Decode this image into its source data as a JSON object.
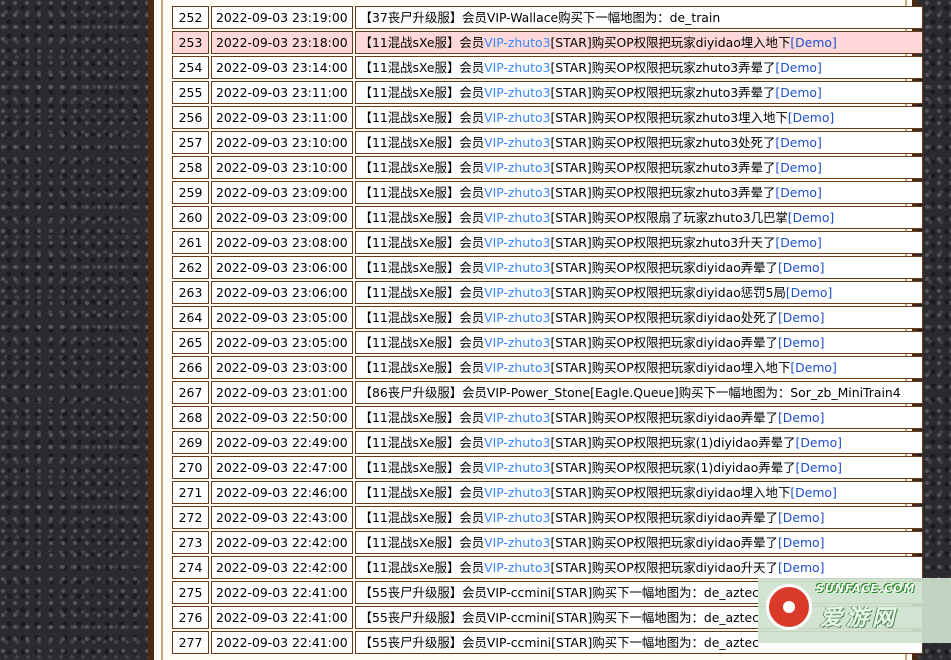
{
  "rows": [
    {
      "id": "252",
      "time": "2022-09-03 23:19:00",
      "prefix": "【37丧尸升级服】会员VIP-Wallace购买下一幅地图为：de_train",
      "vip": "",
      "suffix": "",
      "demo": "",
      "highlight": false
    },
    {
      "id": "253",
      "time": "2022-09-03 23:18:00",
      "prefix": "【11混战sXe服】会员",
      "vip": "VIP-zhuto3",
      "suffix": "[STAR]购买OP权限把玩家diyidao埋入地下",
      "demo": "[Demo]",
      "highlight": true
    },
    {
      "id": "254",
      "time": "2022-09-03 23:14:00",
      "prefix": "【11混战sXe服】会员",
      "vip": "VIP-zhuto3",
      "suffix": "[STAR]购买OP权限把玩家zhuto3弄晕了",
      "demo": "[Demo]",
      "highlight": false
    },
    {
      "id": "255",
      "time": "2022-09-03 23:11:00",
      "prefix": "【11混战sXe服】会员",
      "vip": "VIP-zhuto3",
      "suffix": "[STAR]购买OP权限把玩家zhuto3弄晕了",
      "demo": "[Demo]",
      "highlight": false
    },
    {
      "id": "256",
      "time": "2022-09-03 23:11:00",
      "prefix": "【11混战sXe服】会员",
      "vip": "VIP-zhuto3",
      "suffix": "[STAR]购买OP权限把玩家zhuto3埋入地下",
      "demo": "[Demo]",
      "highlight": false
    },
    {
      "id": "257",
      "time": "2022-09-03 23:10:00",
      "prefix": "【11混战sXe服】会员",
      "vip": "VIP-zhuto3",
      "suffix": "[STAR]购买OP权限把玩家zhuto3处死了",
      "demo": "[Demo]",
      "highlight": false
    },
    {
      "id": "258",
      "time": "2022-09-03 23:10:00",
      "prefix": "【11混战sXe服】会员",
      "vip": "VIP-zhuto3",
      "suffix": "[STAR]购买OP权限把玩家zhuto3弄晕了",
      "demo": "[Demo]",
      "highlight": false
    },
    {
      "id": "259",
      "time": "2022-09-03 23:09:00",
      "prefix": "【11混战sXe服】会员",
      "vip": "VIP-zhuto3",
      "suffix": "[STAR]购买OP权限把玩家zhuto3弄晕了",
      "demo": "[Demo]",
      "highlight": false
    },
    {
      "id": "260",
      "time": "2022-09-03 23:09:00",
      "prefix": "【11混战sXe服】会员",
      "vip": "VIP-zhuto3",
      "suffix": "[STAR]购买OP权限扇了玩家zhuto3几巴掌",
      "demo": "[Demo]",
      "highlight": false
    },
    {
      "id": "261",
      "time": "2022-09-03 23:08:00",
      "prefix": "【11混战sXe服】会员",
      "vip": "VIP-zhuto3",
      "suffix": "[STAR]购买OP权限把玩家zhuto3升天了",
      "demo": "[Demo]",
      "highlight": false
    },
    {
      "id": "262",
      "time": "2022-09-03 23:06:00",
      "prefix": "【11混战sXe服】会员",
      "vip": "VIP-zhuto3",
      "suffix": "[STAR]购买OP权限把玩家diyidao弄晕了",
      "demo": "[Demo]",
      "highlight": false
    },
    {
      "id": "263",
      "time": "2022-09-03 23:06:00",
      "prefix": "【11混战sXe服】会员",
      "vip": "VIP-zhuto3",
      "suffix": "[STAR]购买OP权限把玩家diyidao惩罚5局",
      "demo": "[Demo]",
      "highlight": false
    },
    {
      "id": "264",
      "time": "2022-09-03 23:05:00",
      "prefix": "【11混战sXe服】会员",
      "vip": "VIP-zhuto3",
      "suffix": "[STAR]购买OP权限把玩家diyidao处死了",
      "demo": "[Demo]",
      "highlight": false
    },
    {
      "id": "265",
      "time": "2022-09-03 23:05:00",
      "prefix": "【11混战sXe服】会员",
      "vip": "VIP-zhuto3",
      "suffix": "[STAR]购买OP权限把玩家diyidao弄晕了",
      "demo": "[Demo]",
      "highlight": false
    },
    {
      "id": "266",
      "time": "2022-09-03 23:03:00",
      "prefix": "【11混战sXe服】会员",
      "vip": "VIP-zhuto3",
      "suffix": "[STAR]购买OP权限把玩家diyidao埋入地下",
      "demo": "[Demo]",
      "highlight": false
    },
    {
      "id": "267",
      "time": "2022-09-03 23:01:00",
      "prefix": "【86丧尸升级服】会员VIP-Power_Stone[Eagle.Queue]购买下一幅地图为：Sor_zb_MiniTrain4",
      "vip": "",
      "suffix": "",
      "demo": "",
      "highlight": false
    },
    {
      "id": "268",
      "time": "2022-09-03 22:50:00",
      "prefix": "【11混战sXe服】会员",
      "vip": "VIP-zhuto3",
      "suffix": "[STAR]购买OP权限把玩家diyidao弄晕了",
      "demo": "[Demo]",
      "highlight": false
    },
    {
      "id": "269",
      "time": "2022-09-03 22:49:00",
      "prefix": "【11混战sXe服】会员",
      "vip": "VIP-zhuto3",
      "suffix": "[STAR]购买OP权限把玩家(1)diyidao弄晕了",
      "demo": "[Demo]",
      "highlight": false
    },
    {
      "id": "270",
      "time": "2022-09-03 22:47:00",
      "prefix": "【11混战sXe服】会员",
      "vip": "VIP-zhuto3",
      "suffix": "[STAR]购买OP权限把玩家(1)diyidao弄晕了",
      "demo": "[Demo]",
      "highlight": false
    },
    {
      "id": "271",
      "time": "2022-09-03 22:46:00",
      "prefix": "【11混战sXe服】会员",
      "vip": "VIP-zhuto3",
      "suffix": "[STAR]购买OP权限把玩家diyidao埋入地下",
      "demo": "[Demo]",
      "highlight": false
    },
    {
      "id": "272",
      "time": "2022-09-03 22:43:00",
      "prefix": "【11混战sXe服】会员",
      "vip": "VIP-zhuto3",
      "suffix": "[STAR]购买OP权限把玩家diyidao弄晕了",
      "demo": "[Demo]",
      "highlight": false
    },
    {
      "id": "273",
      "time": "2022-09-03 22:42:00",
      "prefix": "【11混战sXe服】会员",
      "vip": "VIP-zhuto3",
      "suffix": "[STAR]购买OP权限把玩家diyidao弄晕了",
      "demo": "[Demo]",
      "highlight": false
    },
    {
      "id": "274",
      "time": "2022-09-03 22:42:00",
      "prefix": "【11混战sXe服】会员",
      "vip": "VIP-zhuto3",
      "suffix": "[STAR]购买OP权限把玩家diyidao升天了",
      "demo": "[Demo]",
      "highlight": false
    },
    {
      "id": "275",
      "time": "2022-09-03 22:41:00",
      "prefix": "【55丧尸升级服】会员VIP-ccmini[STAR]购买下一幅地图为：de_aztec",
      "vip": "",
      "suffix": "",
      "demo": "",
      "highlight": false
    },
    {
      "id": "276",
      "time": "2022-09-03 22:41:00",
      "prefix": "【55丧尸升级服】会员VIP-ccmini[STAR]购买下一幅地图为：de_aztec",
      "vip": "",
      "suffix": "",
      "demo": "",
      "highlight": false
    },
    {
      "id": "277",
      "time": "2022-09-03 22:41:00",
      "prefix": "【55丧尸升级服】会员VIP-ccmini[STAR]购买下一幅地图为：de_aztec",
      "vip": "",
      "suffix": "",
      "demo": "",
      "highlight": false
    }
  ],
  "watermark": {
    "top_text": "SUNFACE.COM",
    "main_text": "爱游网"
  },
  "colors": {
    "vip_link": "#3a86ff",
    "demo_link": "#1e4fc8",
    "highlight_row": "#ffd9d9",
    "frame": "#4a2a12"
  }
}
